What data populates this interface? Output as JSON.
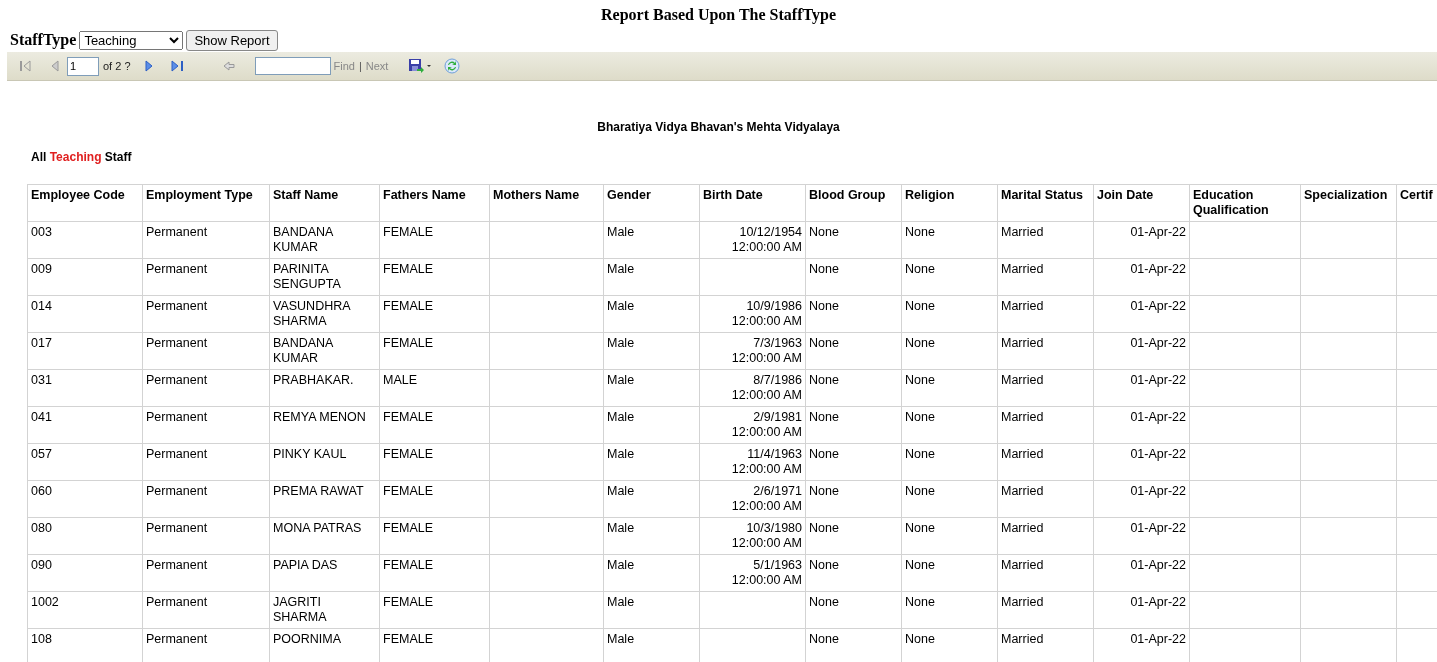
{
  "title": "Report Based Upon The StaffType",
  "filter": {
    "label": "StaffType",
    "value": "Teaching",
    "button": "Show Report"
  },
  "toolbar": {
    "page": "1",
    "page_count": "of 2 ?",
    "find": "Find",
    "separator": "|",
    "next": "Next"
  },
  "report": {
    "school": "Bharatiya Vidya Bhavan's Mehta Vidyalaya",
    "caption": {
      "prefix": "All",
      "highlight": "Teaching",
      "suffix": "Staff"
    }
  },
  "table": {
    "columns": [
      "Employee Code",
      "Employment Type",
      "Staff Name",
      "Fathers Name",
      "Mothers Name",
      "Gender",
      "Birth Date",
      "Blood Group",
      "Religion",
      "Marital Status",
      "Join Date",
      "Education Qualification",
      "Specialization",
      "Certif"
    ],
    "rows": [
      [
        "003",
        "Permanent",
        "BANDANA KUMAR",
        "FEMALE",
        "",
        "Male",
        "10/12/1954 12:00:00 AM",
        "None",
        "None",
        "Married",
        "01-Apr-22",
        "",
        "",
        ""
      ],
      [
        "009",
        "Permanent",
        "PARINITA SENGUPTA",
        "FEMALE",
        "",
        "Male",
        "",
        "None",
        "None",
        "Married",
        "01-Apr-22",
        "",
        "",
        ""
      ],
      [
        "014",
        "Permanent",
        "VASUNDHRA SHARMA",
        "FEMALE",
        "",
        "Male",
        "10/9/1986 12:00:00 AM",
        "None",
        "None",
        "Married",
        "01-Apr-22",
        "",
        "",
        ""
      ],
      [
        "017",
        "Permanent",
        "BANDANA KUMAR",
        "FEMALE",
        "",
        "Male",
        "7/3/1963 12:00:00 AM",
        "None",
        "None",
        "Married",
        "01-Apr-22",
        "",
        "",
        ""
      ],
      [
        "031",
        "Permanent",
        "PRABHAKAR.",
        "MALE",
        "",
        "Male",
        "8/7/1986 12:00:00 AM",
        "None",
        "None",
        "Married",
        "01-Apr-22",
        "",
        "",
        ""
      ],
      [
        "041",
        "Permanent",
        "REMYA MENON",
        "FEMALE",
        "",
        "Male",
        "2/9/1981 12:00:00 AM",
        "None",
        "None",
        "Married",
        "01-Apr-22",
        "",
        "",
        ""
      ],
      [
        "057",
        "Permanent",
        "PINKY KAUL",
        "FEMALE",
        "",
        "Male",
        "11/4/1963 12:00:00 AM",
        "None",
        "None",
        "Married",
        "01-Apr-22",
        "",
        "",
        ""
      ],
      [
        "060",
        "Permanent",
        "PREMA RAWAT",
        "FEMALE",
        "",
        "Male",
        "2/6/1971 12:00:00 AM",
        "None",
        "None",
        "Married",
        "01-Apr-22",
        "",
        "",
        ""
      ],
      [
        "080",
        "Permanent",
        "MONA PATRAS",
        "FEMALE",
        "",
        "Male",
        "10/3/1980 12:00:00 AM",
        "None",
        "None",
        "Married",
        "01-Apr-22",
        "",
        "",
        ""
      ],
      [
        "090",
        "Permanent",
        "PAPIA DAS",
        "FEMALE",
        "",
        "Male",
        "5/1/1963 12:00:00 AM",
        "None",
        "None",
        "Married",
        "01-Apr-22",
        "",
        "",
        ""
      ],
      [
        "1002",
        "Permanent",
        "JAGRITI SHARMA",
        "FEMALE",
        "",
        "Male",
        "",
        "None",
        "None",
        "Married",
        "01-Apr-22",
        "",
        "",
        ""
      ],
      [
        "108",
        "Permanent",
        "POORNIMA",
        "FEMALE",
        "",
        "Male",
        "",
        "None",
        "None",
        "Married",
        "01-Apr-22",
        "",
        "",
        ""
      ]
    ]
  }
}
